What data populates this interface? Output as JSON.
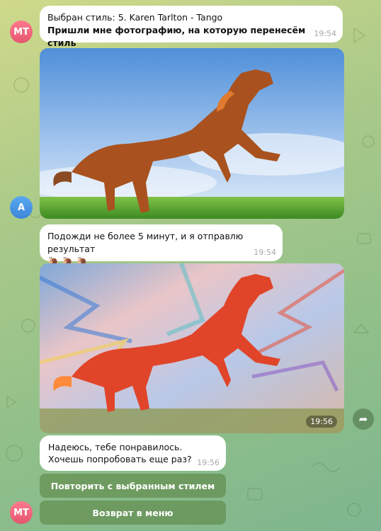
{
  "colors": {
    "bubble": "#ffffff",
    "button": "#58803c",
    "avatar_mt": "#e3566f",
    "avatar_a": "#3d86d8"
  },
  "messages": [
    {
      "sender_initials": "MT",
      "line1": "Выбран стиль: 5. Karen Tarlton - Tango",
      "line2": "Пришли мне фотографию, на которую перенесём стиль",
      "time": "19:54"
    },
    {
      "sender_initials": "A",
      "content": "photo-horse"
    },
    {
      "text": "Подожди не более 5 минут, и я отправлю результат",
      "emoji": "🐌 🐌 🐌",
      "time": "19:54"
    },
    {
      "content": "stylized-photo-horse",
      "time": "19:56"
    },
    {
      "sender_initials": "MT",
      "line1": "Надеюсь, тебе понравилось.",
      "line2": "Хочешь попробовать еще раз?",
      "time": "19:56"
    }
  ],
  "buttons": {
    "repeat_label": "Повторить с выбранным стилем",
    "menu_label": "Возврат в меню"
  }
}
